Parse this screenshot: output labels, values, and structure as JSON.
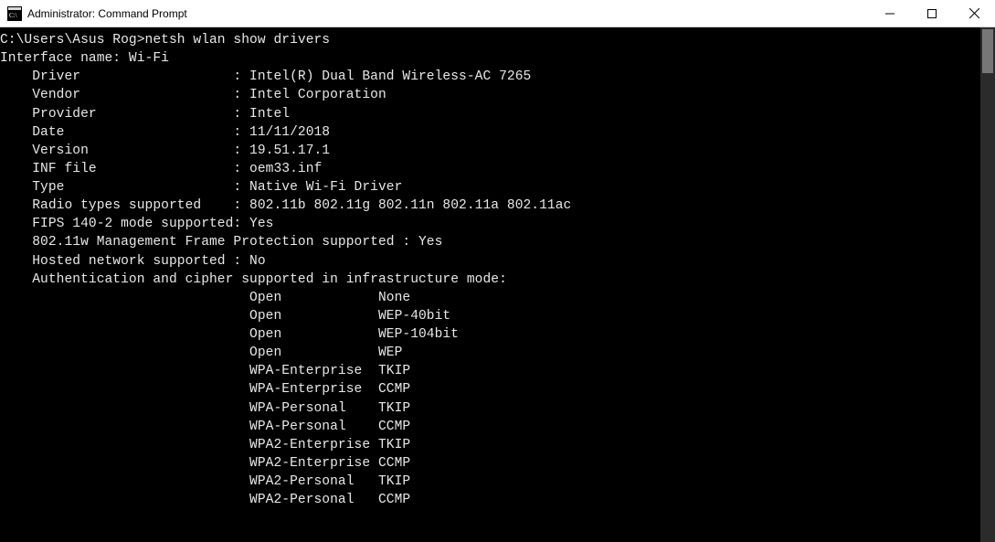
{
  "window": {
    "title": "Administrator: Command Prompt"
  },
  "terminal": {
    "prompt_path": "C:\\Users\\Asus Rog>",
    "command": "netsh wlan show drivers",
    "interface_label": "Interface name:",
    "interface_value": "Wi-Fi",
    "fields": [
      {
        "label": "Driver",
        "value": "Intel(R) Dual Band Wireless-AC 7265"
      },
      {
        "label": "Vendor",
        "value": "Intel Corporation"
      },
      {
        "label": "Provider",
        "value": "Intel"
      },
      {
        "label": "Date",
        "value": "11/11/2018"
      },
      {
        "label": "Version",
        "value": "19.51.17.1"
      },
      {
        "label": "INF file",
        "value": "oem33.inf"
      },
      {
        "label": "Type",
        "value": "Native Wi-Fi Driver"
      },
      {
        "label": "Radio types supported",
        "value": "802.11b 802.11g 802.11n 802.11a 802.11ac"
      },
      {
        "label": "FIPS 140-2 mode supported",
        "value": "Yes"
      }
    ],
    "mfp_line": "802.11w Management Frame Protection supported : Yes",
    "hosted_label": "Hosted network supported ",
    "hosted_value": "No",
    "auth_header": "Authentication and cipher supported in infrastructure mode:",
    "auth_rows": [
      {
        "auth": "Open",
        "cipher": "None"
      },
      {
        "auth": "Open",
        "cipher": "WEP-40bit"
      },
      {
        "auth": "Open",
        "cipher": "WEP-104bit"
      },
      {
        "auth": "Open",
        "cipher": "WEP"
      },
      {
        "auth": "WPA-Enterprise",
        "cipher": "TKIP"
      },
      {
        "auth": "WPA-Enterprise",
        "cipher": "CCMP"
      },
      {
        "auth": "WPA-Personal",
        "cipher": "TKIP"
      },
      {
        "auth": "WPA-Personal",
        "cipher": "CCMP"
      },
      {
        "auth": "WPA2-Enterprise",
        "cipher": "TKIP"
      },
      {
        "auth": "WPA2-Enterprise",
        "cipher": "CCMP"
      },
      {
        "auth": "WPA2-Personal",
        "cipher": "TKIP"
      },
      {
        "auth": "WPA2-Personal",
        "cipher": "CCMP"
      }
    ]
  }
}
